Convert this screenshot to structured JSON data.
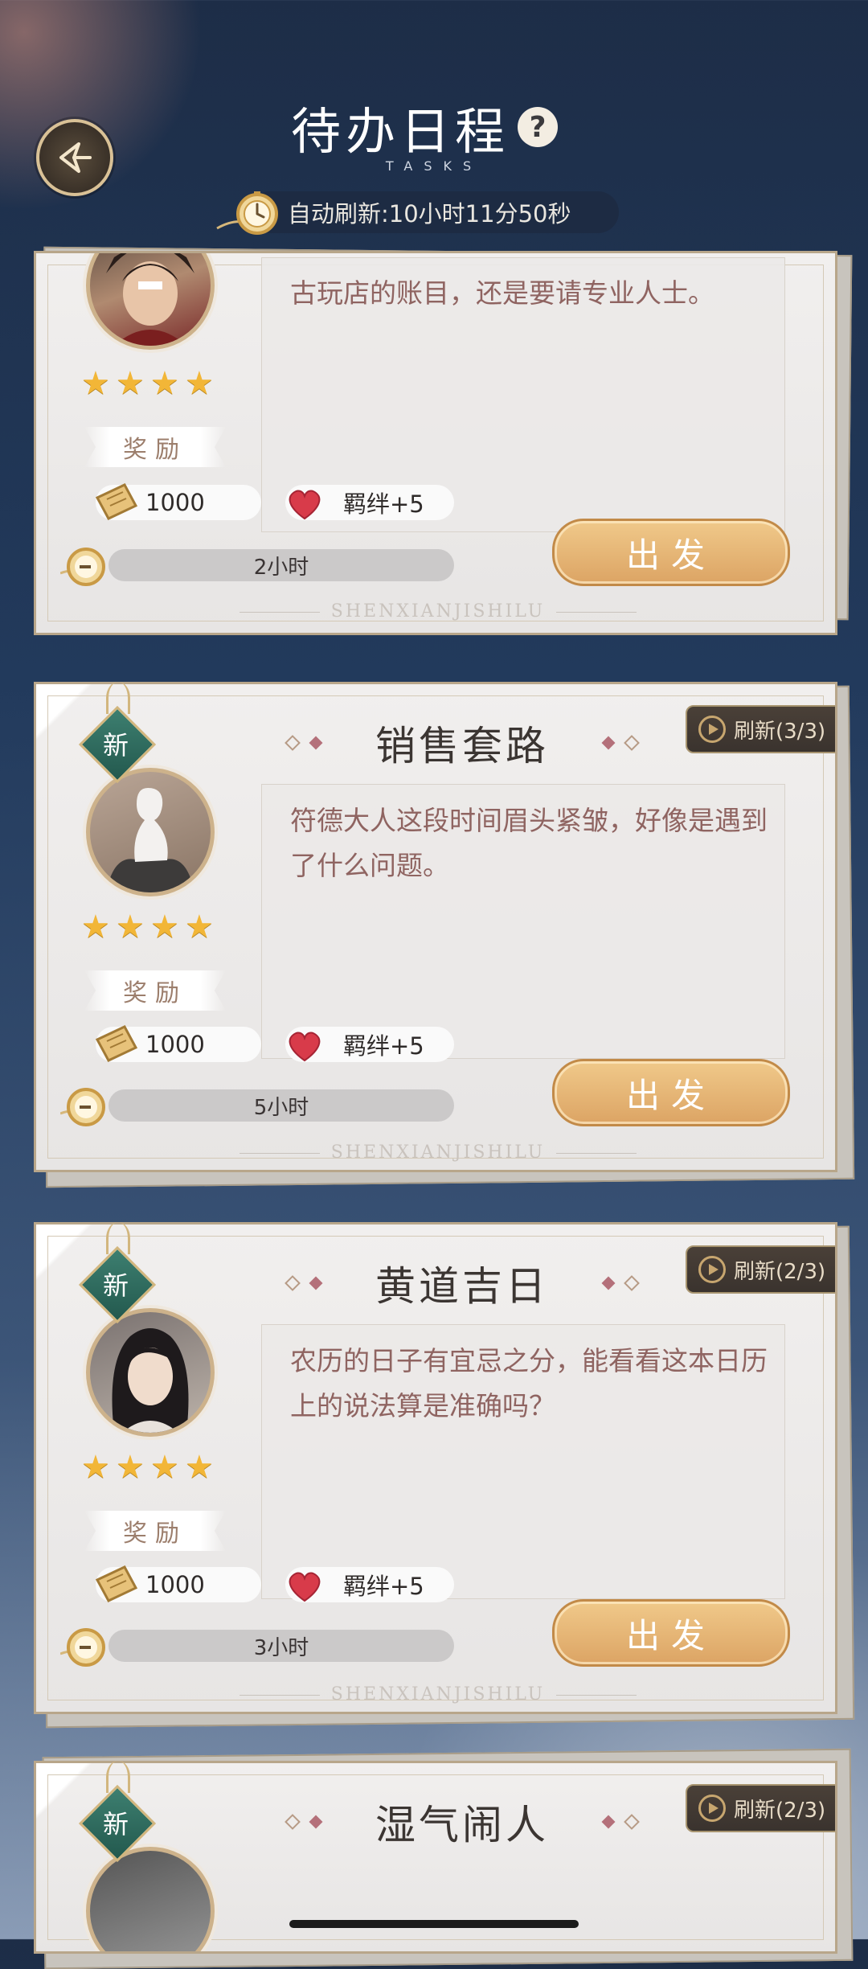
{
  "header": {
    "title": "待办日程",
    "subtitle": "TASKS",
    "help_icon": "?",
    "refresh_text": "自动刷新:10小时11分50秒"
  },
  "cards": [
    {
      "description": "古玩店的账目，还是要请专业人士。",
      "stars": 4,
      "reward_label": "奖励",
      "coin_value": "1000",
      "bond_value": "羁绊+5",
      "duration": "2小时",
      "go_label": "出发",
      "brand": "SHENXIANJISHILU"
    },
    {
      "tag": "新",
      "title": "销售套路",
      "refresh": "刷新(3/3)",
      "description": "符德大人这段时间眉头紧皱，好像是遇到了什么问题。",
      "stars": 4,
      "reward_label": "奖励",
      "coin_value": "1000",
      "bond_value": "羁绊+5",
      "duration": "5小时",
      "go_label": "出发",
      "brand": "SHENXIANJISHILU"
    },
    {
      "tag": "新",
      "title": "黄道吉日",
      "refresh": "刷新(2/3)",
      "description": "农历的日子有宜忌之分，能看看这本日历上的说法算是准确吗？",
      "stars": 4,
      "reward_label": "奖励",
      "coin_value": "1000",
      "bond_value": "羁绊+5",
      "duration": "3小时",
      "go_label": "出发",
      "brand": "SHENXIANJISHILU"
    },
    {
      "tag": "新",
      "title": "湿气闹人",
      "refresh": "刷新(2/3)"
    }
  ],
  "colors": {
    "accent_gold": "#dca464",
    "tag_green": "#2e6b5e",
    "description_text": "#8f6461",
    "star": "#f2b637"
  }
}
